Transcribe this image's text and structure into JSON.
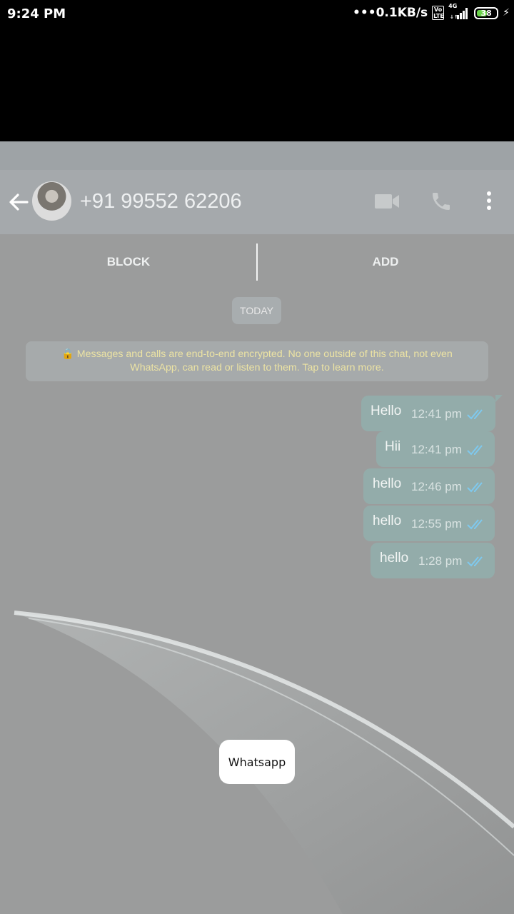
{
  "status_bar": {
    "time": "9:24 PM",
    "network_speed": "0.1KB/s",
    "volte_badge": "Vo LTE",
    "network_type": "4G",
    "battery_level": "38",
    "icons": [
      "volte-icon",
      "signal-icon",
      "battery-icon",
      "charging-icon"
    ]
  },
  "chat_header": {
    "contact": "+91 99552 62206",
    "icons": [
      "back-arrow-icon",
      "avatar",
      "video-call-icon",
      "voice-call-icon",
      "more-options-icon"
    ]
  },
  "actions": {
    "block_label": "BLOCK",
    "add_label": "ADD"
  },
  "date_chip": "TODAY",
  "encryption_notice": {
    "icon": "lock-icon",
    "line1": "Messages and calls are end-to-end encrypted. No one outside of this chat, not even",
    "line2": "WhatsApp, can read or listen to them. Tap to learn more."
  },
  "messages": [
    {
      "text": "Hello",
      "time": "12:41 pm",
      "status": "read"
    },
    {
      "text": "Hii",
      "time": "12:41 pm",
      "status": "read"
    },
    {
      "text": "hello",
      "time": "12:46 pm",
      "status": "read"
    },
    {
      "text": "hello",
      "time": "12:55 pm",
      "status": "read"
    },
    {
      "text": "hello",
      "time": "1:28 pm",
      "status": "read"
    }
  ],
  "toast": "Whatsapp",
  "colors": {
    "toolbar": "#a5a9ac",
    "bubble": "#93acaa",
    "read_ticks": "#7fc9ee",
    "encryption_text": "#ece3a3",
    "battery_fill": "#6ad24a"
  }
}
